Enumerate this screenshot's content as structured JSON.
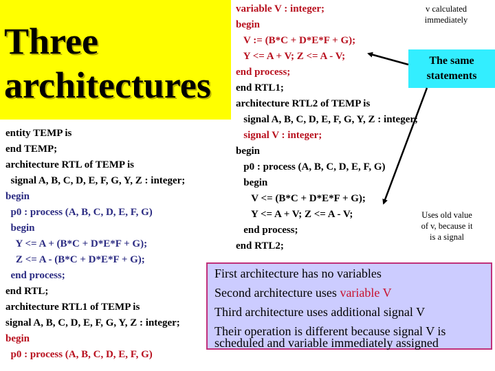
{
  "title": {
    "line1": "Three",
    "line2": "architectures"
  },
  "left_code": [
    {
      "text": "entity TEMP is",
      "color": "black"
    },
    {
      "text": "end TEMP;",
      "color": "black"
    },
    {
      "text": "architecture RTL of TEMP is",
      "color": "black"
    },
    {
      "text": "  signal A, B, C, D, E, F, G, Y, Z : integer;",
      "color": "black"
    },
    {
      "text": "begin",
      "color": "navy"
    },
    {
      "text": "  p0 : process (A, B, C, D, E, F, G)",
      "color": "navy"
    },
    {
      "text": "  begin",
      "color": "navy"
    },
    {
      "text": "    Y <= A + (B*C + D*E*F + G);",
      "color": "navy"
    },
    {
      "text": "    Z <= A - (B*C + D*E*F + G);",
      "color": "navy"
    },
    {
      "text": "  end process;",
      "color": "navy"
    },
    {
      "text": "end RTL;",
      "color": "black"
    },
    {
      "text": "architecture RTL1 of TEMP is",
      "color": "black"
    },
    {
      "text": "signal A, B, C, D, E, F, G, Y, Z : integer;",
      "color": "black"
    },
    {
      "text": "begin",
      "color": "red"
    },
    {
      "text": "  p0 : process (A, B, C, D, E, F, G)",
      "color": "red"
    }
  ],
  "right_code": [
    {
      "text": "variable V : integer;",
      "color": "red"
    },
    {
      "text": "begin",
      "color": "red"
    },
    {
      "text": "   V := (B*C + D*E*F + G);",
      "color": "red"
    },
    {
      "text": "   Y <= A + V; Z <= A - V;",
      "color": "red"
    },
    {
      "text": "end process;",
      "color": "red"
    },
    {
      "text": "end RTL1;",
      "color": "black"
    },
    {
      "text": "architecture RTL2 of TEMP is",
      "color": "black"
    },
    {
      "text": "   signal A, B, C, D, E, F, G, Y, Z : integer;",
      "color": "black"
    },
    {
      "text": "   signal V : integer;",
      "color": "red"
    },
    {
      "text": "begin",
      "color": "black"
    },
    {
      "text": "   p0 : process (A, B, C, D, E, F, G)",
      "color": "black"
    },
    {
      "text": "   begin",
      "color": "black"
    },
    {
      "text": "      V <= (B*C + D*E*F + G);",
      "color": "black"
    },
    {
      "text": "      Y <= A + V; Z <= A - V;",
      "color": "black"
    },
    {
      "text": "   end process;",
      "color": "black"
    },
    {
      "text": "end RTL2;",
      "color": "black"
    }
  ],
  "notes": {
    "top_line1": "v calculated",
    "top_line2": "immediately",
    "mid_line1": "Uses old value",
    "mid_line2": "of v, because it",
    "mid_line3": "is a signal"
  },
  "callout": {
    "line1": "The same",
    "line2": "statements"
  },
  "summary": {
    "line1": "First architecture has no variables",
    "line2_prefix": "Second architecture uses ",
    "line2_highlight": "variable V",
    "line3": "Third architecture uses additional signal V",
    "line4a": "Their operation is different because signal V is",
    "line4b": "scheduled and variable immediately assigned"
  },
  "colors": {
    "title_bg": "#ffff00",
    "callout_bg": "#33eeff",
    "summary_bg": "#ccccff",
    "summary_border": "#c0307a",
    "code_red": "#b8101e",
    "code_navy": "#2b2b82"
  }
}
